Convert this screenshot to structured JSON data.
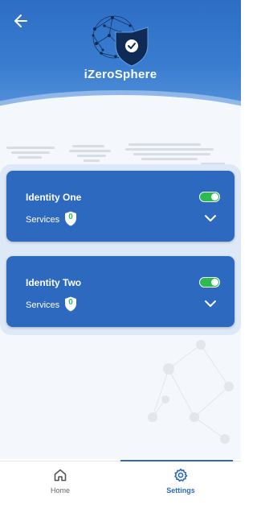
{
  "header": {
    "brand": "iZeroSphere",
    "back_icon": "arrow-left-icon",
    "logo_icon": "shield-check-globe-logo"
  },
  "identities": [
    {
      "name": "Identity One",
      "services_label": "Services",
      "services_count": "0",
      "enabled": true
    },
    {
      "name": "Identity Two",
      "services_label": "Services",
      "services_count": "0",
      "enabled": true
    }
  ],
  "bottom_nav": {
    "items": [
      {
        "label": "Home",
        "icon": "home-icon",
        "active": false
      },
      {
        "label": "Settings",
        "icon": "gear-icon",
        "active": true
      }
    ]
  },
  "colors": {
    "header_blue": "#2d6ec4",
    "card_blue": "#2e69c0",
    "toggle_green": "#2dbb4f",
    "active_nav": "#2e69c0"
  }
}
